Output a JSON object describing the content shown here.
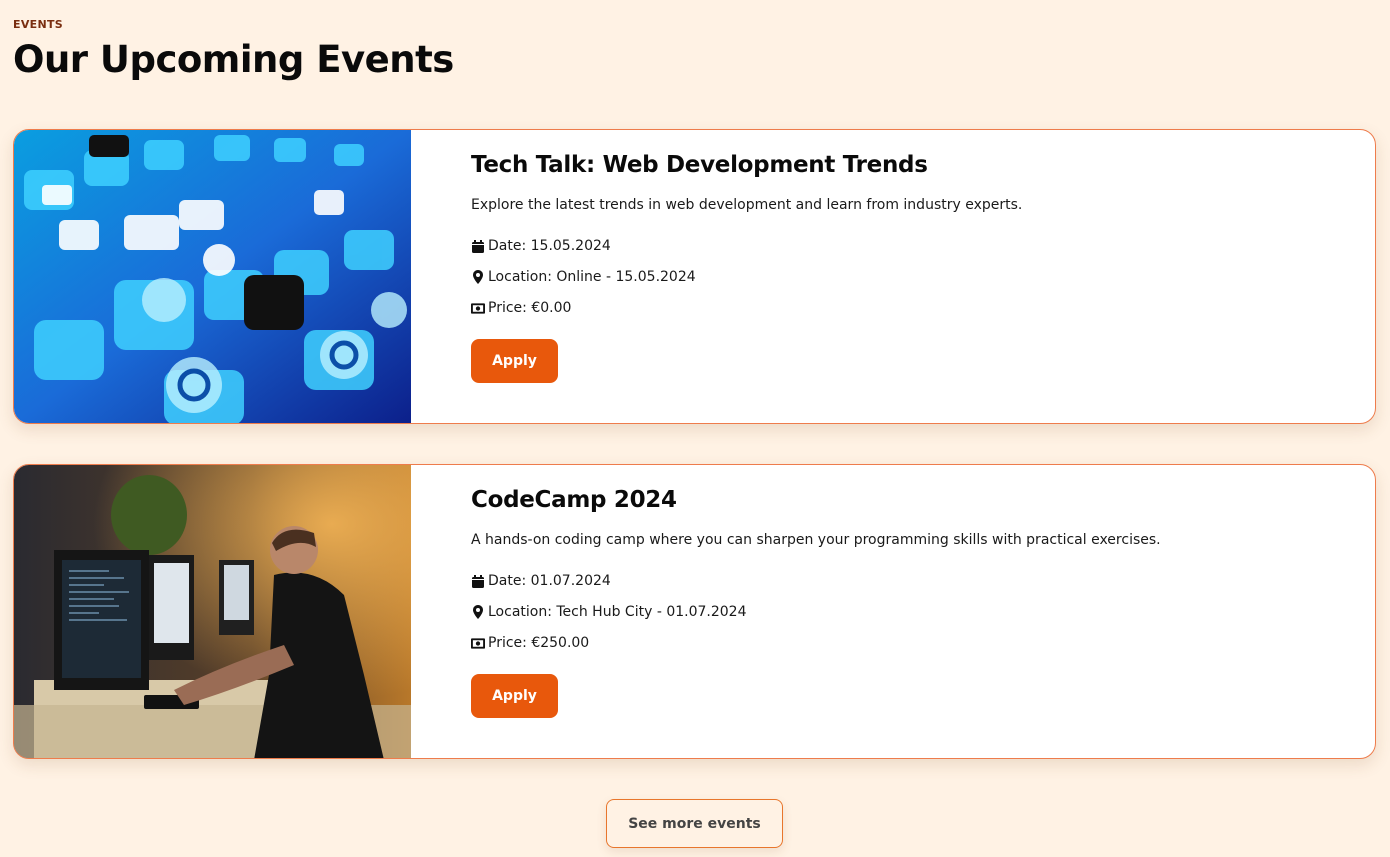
{
  "section": {
    "eyebrow": "EVENTS",
    "title": "Our Upcoming Events"
  },
  "events": [
    {
      "title": "Tech Talk: Web Development Trends",
      "description": "Explore the latest trends in web development and learn from industry experts.",
      "date": "Date: 15.05.2024",
      "location": "Location: Online - 15.05.2024",
      "price": "Price: €0.00",
      "apply_label": "Apply",
      "image": "social-media-app-icons-photo"
    },
    {
      "title": "CodeCamp 2024",
      "description": "A hands-on coding camp where you can sharpen your programming skills with practical exercises.",
      "date": "Date: 01.07.2024",
      "location": "Location: Tech Hub City - 01.07.2024",
      "price": "Price: €250.00",
      "apply_label": "Apply",
      "image": "programmer-at-computer-photo"
    }
  ],
  "footer": {
    "more_label": "See more events"
  },
  "icons": {
    "date": "calendar-icon",
    "location": "map-marker-icon",
    "price": "money-bill-icon"
  },
  "colors": {
    "background": "#fff2e4",
    "accent": "#e8580c",
    "card_border": "#ee7c4c",
    "eyebrow": "#7a2e10"
  }
}
